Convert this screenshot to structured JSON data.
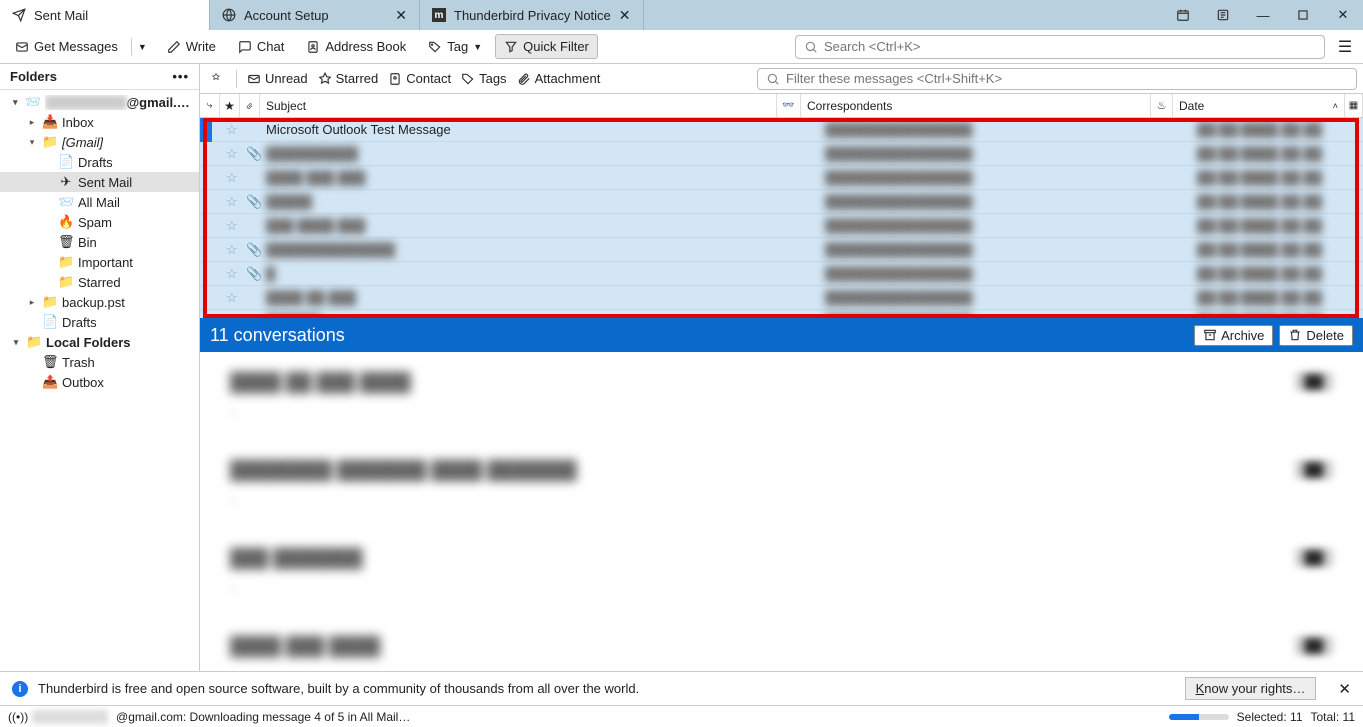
{
  "tabs": [
    {
      "label": "Sent Mail",
      "icon": "send",
      "active": true,
      "closable": false
    },
    {
      "label": "Account Setup",
      "icon": "globe",
      "active": false,
      "closable": true
    },
    {
      "label": "Thunderbird Privacy Notice",
      "icon": "m",
      "active": false,
      "closable": true
    }
  ],
  "toolbar": {
    "get_messages": "Get Messages",
    "write": "Write",
    "chat": "Chat",
    "address_book": "Address Book",
    "tag": "Tag",
    "quick_filter": "Quick Filter",
    "search_placeholder": "Search <Ctrl+K>"
  },
  "folders": {
    "header": "Folders",
    "account_suffix": "@gmail.com",
    "tree": [
      {
        "indent": 0,
        "twisty": "▾",
        "icon": "📨",
        "label_hidden": true,
        "label": "████████",
        "suffix": "@gmail.com",
        "account": true
      },
      {
        "indent": 1,
        "twisty": "▸",
        "icon": "📥",
        "label": "Inbox"
      },
      {
        "indent": 1,
        "twisty": "▾",
        "icon": "📁",
        "label": "[Gmail]",
        "italic": true
      },
      {
        "indent": 2,
        "twisty": "",
        "icon": "📄",
        "label": "Drafts"
      },
      {
        "indent": 2,
        "twisty": "",
        "icon": "✈",
        "label": "Sent Mail",
        "selected": true
      },
      {
        "indent": 2,
        "twisty": "",
        "icon": "📨",
        "label": "All Mail"
      },
      {
        "indent": 2,
        "twisty": "",
        "icon": "🔥",
        "label": "Spam"
      },
      {
        "indent": 2,
        "twisty": "",
        "icon": "🗑",
        "label": "Bin"
      },
      {
        "indent": 2,
        "twisty": "",
        "icon": "📁",
        "label": "Important"
      },
      {
        "indent": 2,
        "twisty": "",
        "icon": "📁",
        "label": "Starred"
      },
      {
        "indent": 1,
        "twisty": "▸",
        "icon": "📁",
        "label": "backup.pst"
      },
      {
        "indent": 1,
        "twisty": "",
        "icon": "📄",
        "label": "Drafts"
      },
      {
        "indent": 0,
        "twisty": "▾",
        "icon": "📁",
        "label": "Local Folders",
        "account": true
      },
      {
        "indent": 1,
        "twisty": "",
        "icon": "🗑",
        "label": "Trash"
      },
      {
        "indent": 1,
        "twisty": "",
        "icon": "📤",
        "label": "Outbox"
      }
    ]
  },
  "quickfilter": {
    "items": [
      "Unread",
      "Starred",
      "Contact",
      "Tags",
      "Attachment"
    ],
    "filter_placeholder": "Filter these messages <Ctrl+Shift+K>"
  },
  "columns": {
    "subject": "Subject",
    "correspondents": "Correspondents",
    "date": "Date"
  },
  "messages": [
    {
      "star": "☆",
      "attach": "",
      "subject": "Microsoft Outlook Test Message",
      "blurred": false
    },
    {
      "star": "☆",
      "attach": "📎",
      "subject": "██████████",
      "blurred": true
    },
    {
      "star": "☆",
      "attach": "",
      "subject": "████ ███ ███",
      "blurred": true
    },
    {
      "star": "☆",
      "attach": "📎",
      "subject": "█████",
      "blurred": true
    },
    {
      "star": "☆",
      "attach": "",
      "subject": "███ ████ ███",
      "blurred": true
    },
    {
      "star": "☆",
      "attach": "📎",
      "subject": "██████████████",
      "blurred": true
    },
    {
      "star": "☆",
      "attach": "📎",
      "subject": "█",
      "blurred": true
    },
    {
      "star": "☆",
      "attach": "",
      "subject": "████ ██ ███",
      "blurred": true
    },
    {
      "star": "☆",
      "attach": "📎",
      "subject": "██████",
      "blurred": true
    }
  ],
  "conversation": {
    "title": "11 conversations",
    "archive": "Archive",
    "delete": "Delete"
  },
  "preview_items": [
    {
      "subject": "████ ██ ███ ████"
    },
    {
      "subject": "████████ ███████ ████ ███████"
    },
    {
      "subject": "███ ███████"
    },
    {
      "subject": "████ ███ ████"
    }
  ],
  "notification": {
    "text": "Thunderbird is free and open source software, built by a community of thousands from all over the world.",
    "button": "Know your rights…"
  },
  "status": {
    "account_suffix": "@gmail.com: ",
    "message": "Downloading message 4 of 5 in All Mail…",
    "selected_label": "Selected:",
    "selected": "11",
    "total_label": "Total:",
    "total": "11",
    "progress_pct": 50
  }
}
